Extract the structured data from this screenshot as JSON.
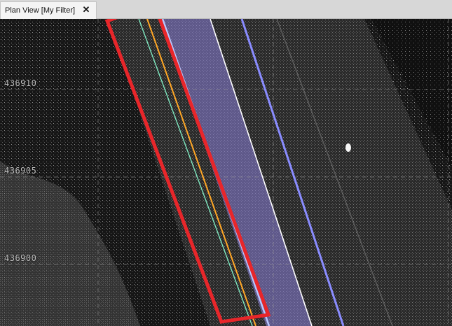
{
  "window": {
    "tab_title": "Plan View [My Filter]",
    "close_glyph": "✕"
  },
  "grid": {
    "y_labels": [
      "436910",
      "436905",
      "436900"
    ]
  },
  "colors": {
    "selection_box": "#e8262a",
    "road_overlay": "#8b7fd8",
    "lane_blue": "#8a8cff",
    "edge_white": "#ffffff",
    "line_orange": "#ffa726",
    "line_teal": "#7fe8c0",
    "line_lightblue": "#b8c8ff"
  }
}
